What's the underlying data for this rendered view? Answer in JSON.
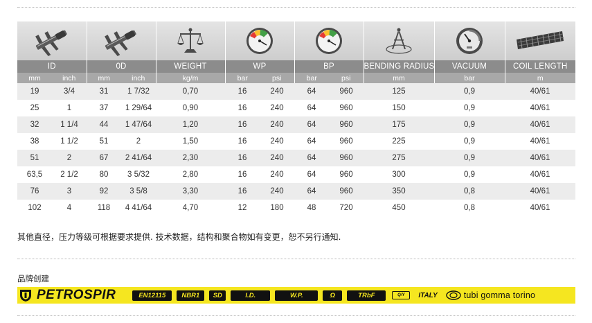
{
  "headers": {
    "id": "ID",
    "od": "0D",
    "weight": "WEIGHT",
    "wp": "WP",
    "bp": "BP",
    "bending_radius": "BENDING RADIUS",
    "vacuum": "VACUUM",
    "coil_length": "COIL LENGTH"
  },
  "units": {
    "id_mm": "mm",
    "id_inch": "inch",
    "od_mm": "mm",
    "od_inch": "inch",
    "weight": "kg/m",
    "wp_bar": "bar",
    "wp_psi": "psi",
    "bp_bar": "bar",
    "bp_psi": "psi",
    "bending_radius": "mm",
    "vacuum": "bar",
    "coil_length": "m"
  },
  "rows": [
    [
      "19",
      "3/4",
      "31",
      "1 7/32",
      "0,70",
      "16",
      "240",
      "64",
      "960",
      "125",
      "0,9",
      "40/61"
    ],
    [
      "25",
      "1",
      "37",
      "1 29/64",
      "0,90",
      "16",
      "240",
      "64",
      "960",
      "150",
      "0,9",
      "40/61"
    ],
    [
      "32",
      "1 1/4",
      "44",
      "1 47/64",
      "1,20",
      "16",
      "240",
      "64",
      "960",
      "175",
      "0,9",
      "40/61"
    ],
    [
      "38",
      "1 1/2",
      "51",
      "2",
      "1,50",
      "16",
      "240",
      "64",
      "960",
      "225",
      "0,9",
      "40/61"
    ],
    [
      "51",
      "2",
      "67",
      "2 41/64",
      "2,30",
      "16",
      "240",
      "64",
      "960",
      "275",
      "0,9",
      "40/61"
    ],
    [
      "63,5",
      "2 1/2",
      "80",
      "3 5/32",
      "2,80",
      "16",
      "240",
      "64",
      "960",
      "300",
      "0,9",
      "40/61"
    ],
    [
      "76",
      "3",
      "92",
      "3 5/8",
      "3,30",
      "16",
      "240",
      "64",
      "960",
      "350",
      "0,8",
      "40/61"
    ],
    [
      "102",
      "4",
      "118",
      "4 41/64",
      "4,70",
      "12",
      "180",
      "48",
      "720",
      "450",
      "0,8",
      "40/61"
    ]
  ],
  "note": "其他直径，压力等级可根据要求提供. 技术数据，结构和聚合物如有变更，恕不另行通知.",
  "brand_caption": "品牌创建",
  "brand": {
    "name": "PETROSPIR",
    "tags": [
      "EN12115",
      "NBR1",
      "SD",
      "I.D.",
      "W.P.",
      "Ω",
      "TRbF"
    ],
    "qy": "Q/Y",
    "country": "ITALY",
    "maker": "tubi gomma torino"
  },
  "icons": [
    "caliper-icon",
    "caliper-icon",
    "scale-icon",
    "pressure-gauge-icon",
    "pressure-gauge-icon",
    "compass-icon",
    "vacuum-gauge-icon",
    "hose-coil-icon"
  ]
}
